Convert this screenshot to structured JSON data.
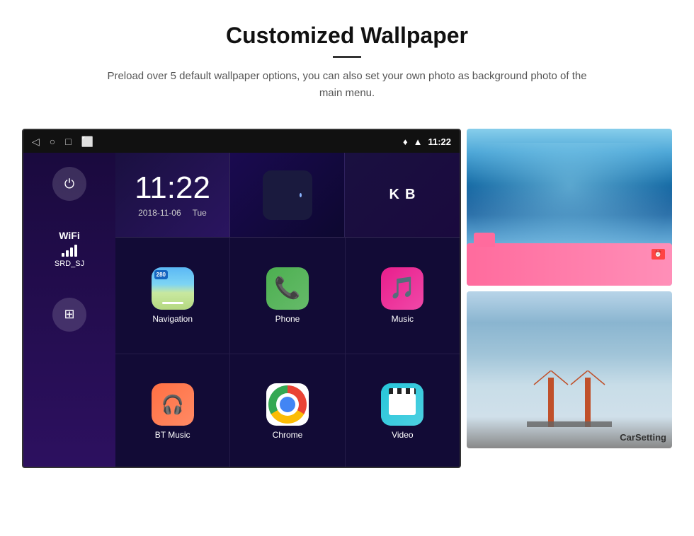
{
  "header": {
    "title": "Customized Wallpaper",
    "description": "Preload over 5 default wallpaper options, you can also set your own photo as background photo of the main menu."
  },
  "android": {
    "status_bar": {
      "time": "11:22",
      "back_icon": "◁",
      "home_icon": "○",
      "recent_icon": "□",
      "photo_icon": "⬜"
    },
    "clock": {
      "time": "11:22",
      "date": "2018-11-06",
      "day": "Tue"
    },
    "wifi": {
      "label": "WiFi",
      "network": "SRD_SJ"
    },
    "apps": [
      {
        "name": "Navigation",
        "icon_type": "nav"
      },
      {
        "name": "Phone",
        "icon_type": "phone"
      },
      {
        "name": "Music",
        "icon_type": "music"
      },
      {
        "name": "BT Music",
        "icon_type": "btmusic"
      },
      {
        "name": "Chrome",
        "icon_type": "chrome"
      },
      {
        "name": "Video",
        "icon_type": "video"
      }
    ],
    "shortcuts": [
      {
        "letter": "K"
      },
      {
        "letter": "B"
      }
    ]
  },
  "thumbnails": [
    {
      "name": "ice-cave",
      "label": ""
    },
    {
      "name": "golden-gate-bridge",
      "label": "CarSetting"
    }
  ]
}
